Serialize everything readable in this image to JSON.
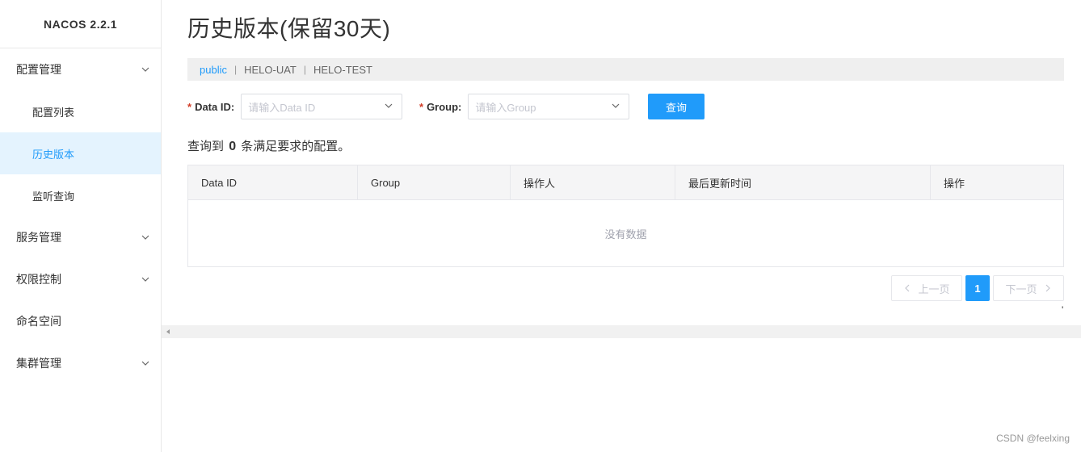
{
  "app": {
    "title": "NACOS 2.2.1"
  },
  "sidebar": {
    "items": [
      {
        "label": "配置管理",
        "type": "group",
        "expanded": true
      },
      {
        "label": "配置列表",
        "type": "sub"
      },
      {
        "label": "历史版本",
        "type": "sub",
        "active": true
      },
      {
        "label": "监听查询",
        "type": "sub"
      },
      {
        "label": "服务管理",
        "type": "group"
      },
      {
        "label": "权限控制",
        "type": "group"
      },
      {
        "label": "命名空间",
        "type": "leaf"
      },
      {
        "label": "集群管理",
        "type": "group"
      }
    ]
  },
  "page": {
    "title": "历史版本(保留30天)"
  },
  "namespaces": {
    "active": "public",
    "items": [
      "public",
      "HELO-UAT",
      "HELO-TEST"
    ],
    "separator": "|"
  },
  "filters": {
    "required_mark": "*",
    "data_id": {
      "label": "Data ID:",
      "placeholder": "请输入Data ID"
    },
    "group": {
      "label": "Group:",
      "placeholder": "请输入Group"
    },
    "query_button": "查询"
  },
  "result": {
    "prefix": "查询到",
    "count": "0",
    "suffix": "条满足要求的配置。"
  },
  "table": {
    "columns": [
      "Data ID",
      "Group",
      "操作人",
      "最后更新时间",
      "操作"
    ],
    "empty_text": "没有数据"
  },
  "pagination": {
    "prev": "上一页",
    "current": "1",
    "next": "下一页"
  },
  "misc": {
    "tick": "'"
  },
  "watermark": "CSDN @feelxing",
  "colors": {
    "accent": "#209bfa",
    "required": "#d23c26",
    "active_bg": "#e4f3fe"
  }
}
